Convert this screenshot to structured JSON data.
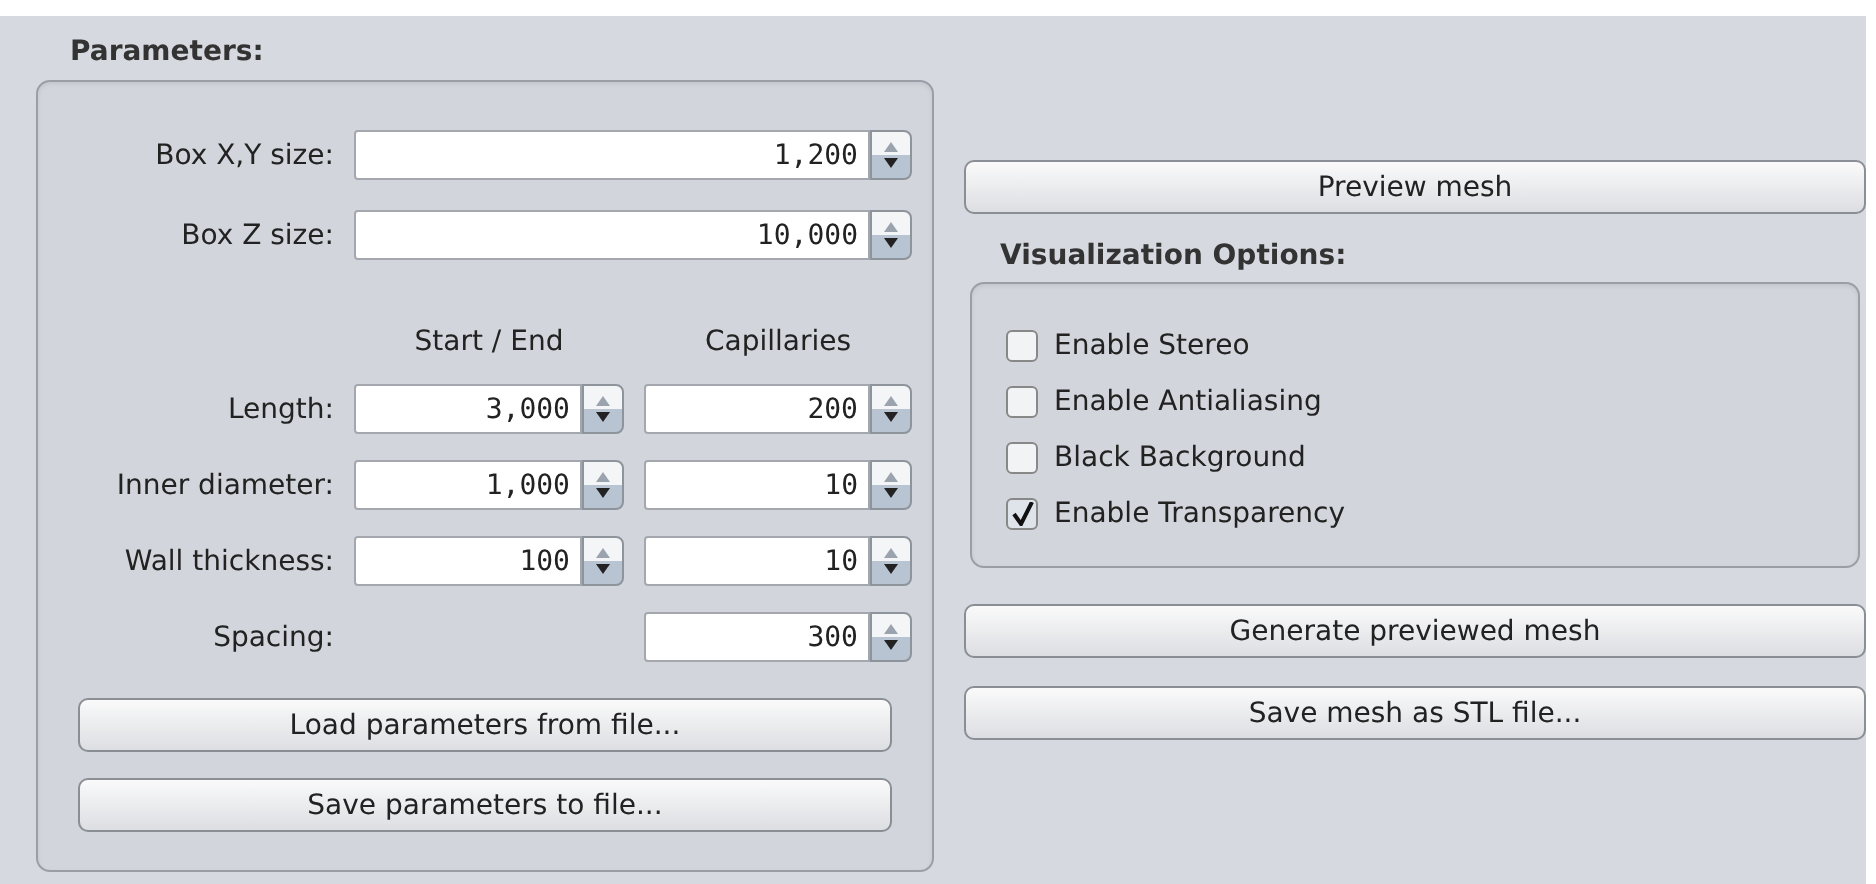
{
  "parameters": {
    "title": "Parameters:",
    "size_rows": [
      {
        "label": "Box X,Y size:",
        "value": "1,200"
      },
      {
        "label": "Box Z size:",
        "value": "10,000"
      }
    ],
    "column_headers": [
      "Start / End",
      "Capillaries"
    ],
    "rows": [
      {
        "label": "Length:",
        "start": "3,000",
        "capillaries": "200"
      },
      {
        "label": "Inner diameter:",
        "start": "1,000",
        "capillaries": "10"
      },
      {
        "label": "Wall thickness:",
        "start": "100",
        "capillaries": "10"
      },
      {
        "label": "Spacing:",
        "capillaries": "300"
      }
    ],
    "buttons": [
      "Load parameters from file...",
      "Save parameters to file..."
    ]
  },
  "preview_button": "Preview mesh",
  "visualization": {
    "title": "Visualization Options:",
    "options": [
      {
        "label": "Enable Stereo",
        "checked": false
      },
      {
        "label": "Enable Antialiasing",
        "checked": false
      },
      {
        "label": "Black Background",
        "checked": false
      },
      {
        "label": "Enable Transparency",
        "checked": true
      }
    ]
  },
  "bottom_buttons": [
    "Generate previewed mesh",
    "Save mesh as STL file..."
  ]
}
